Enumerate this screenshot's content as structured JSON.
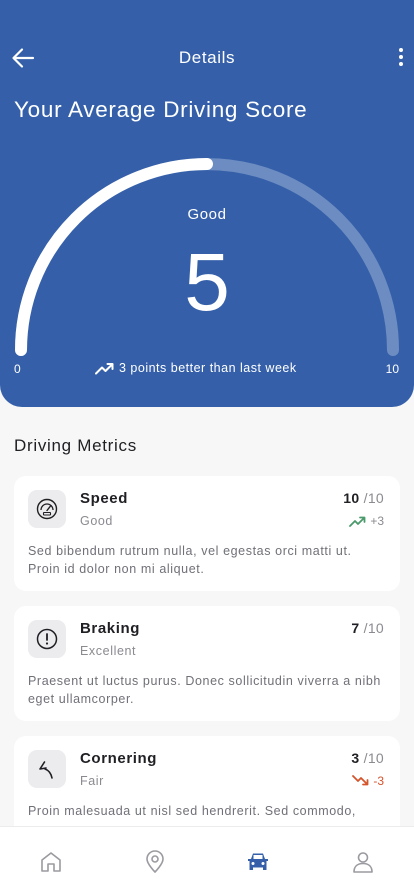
{
  "header": {
    "title": "Details",
    "back_icon": "arrow-left-icon",
    "menu_icon": "more-vertical-icon"
  },
  "score": {
    "heading": "Your Average Driving Score",
    "rating": "Good",
    "value": "5",
    "value_fraction": 0.5,
    "min_label": "0",
    "max_label": "10",
    "trend_text": "3 points better than last week"
  },
  "metrics": {
    "title": "Driving Metrics",
    "items": [
      {
        "name": "Speed",
        "rating": "Good",
        "score": "10",
        "max": "/10",
        "delta": "+3",
        "delta_dir": "up",
        "icon": "speedometer-icon",
        "description": "Sed bibendum rutrum nulla, vel egestas orci matti ut. Proin id dolor non mi aliquet."
      },
      {
        "name": "Braking",
        "rating": "Excellent",
        "score": "7",
        "max": "/10",
        "delta": "",
        "delta_dir": "none",
        "icon": "alert-circle-icon",
        "description": "Praesent ut luctus purus. Donec sollicitudin viverra a nibh eget ullamcorper."
      },
      {
        "name": "Cornering",
        "rating": "Fair",
        "score": "3",
        "max": "/10",
        "delta": "-3",
        "delta_dir": "down",
        "icon": "turn-arrow-icon",
        "description": "Proin malesuada ut nisl sed hendrerit. Sed commodo,"
      }
    ]
  },
  "nav": {
    "items": [
      "home-icon",
      "location-pin-icon",
      "car-icon",
      "user-icon"
    ],
    "active": "car-icon"
  },
  "colors": {
    "primary": "#3560a9",
    "positive": "#4a9a6c",
    "negative": "#d4542c"
  }
}
